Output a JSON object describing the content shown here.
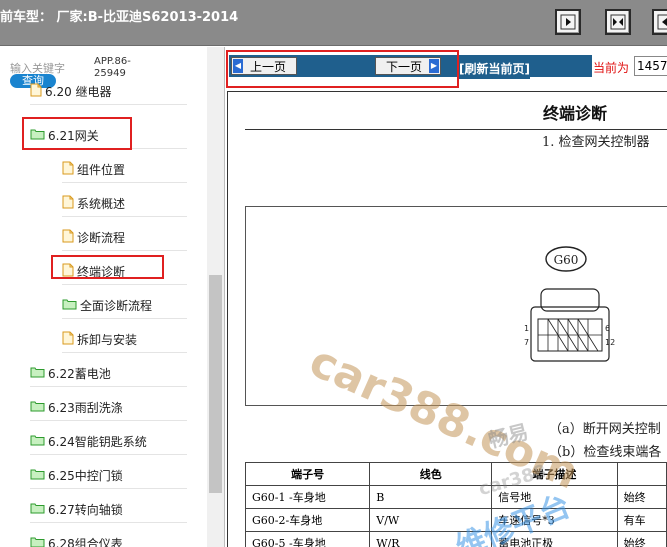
{
  "header": {
    "title": "前车型： 厂家:B-比亚迪S62013-2014",
    "dot": "·"
  },
  "sidebar": {
    "search_label": "输入关键字",
    "search_value_line1": "APP.86-",
    "search_value_line2": "25949",
    "search_button": "查询",
    "items": [
      {
        "label": "6.20  继电器",
        "type": "doc"
      },
      {
        "label": "6.21网关",
        "type": "folder"
      },
      {
        "label": "组件位置",
        "type": "doc"
      },
      {
        "label": "系统概述",
        "type": "doc"
      },
      {
        "label": "诊断流程",
        "type": "doc"
      },
      {
        "label": "终端诊断",
        "type": "doc"
      },
      {
        "label": "全面诊断流程",
        "type": "folder"
      },
      {
        "label": "拆卸与安装",
        "type": "doc"
      },
      {
        "label": "6.22蓄电池",
        "type": "folder"
      },
      {
        "label": "6.23雨刮洗涤",
        "type": "folder"
      },
      {
        "label": "6.24智能钥匙系统",
        "type": "folder"
      },
      {
        "label": "6.25中控门锁",
        "type": "folder"
      },
      {
        "label": "6.27转向轴锁",
        "type": "folder"
      },
      {
        "label": "6.28组合仪表",
        "type": "folder"
      }
    ]
  },
  "nav": {
    "prev_label": "上一页",
    "next_label": "下一页",
    "refresh_label": "[刷新当前页]",
    "current_label": "当前为",
    "current_value": "1457"
  },
  "document": {
    "title": "终端诊断",
    "step1": "1.   检查网关控制器",
    "connector_label": "G60",
    "pin_labels": [
      "1",
      "7",
      "6",
      "12"
    ],
    "note_a": "（a）断开网关控制",
    "note_b": "（b）检查线束端各",
    "table": {
      "headers": [
        "端子号",
        "线色",
        "端子描述",
        ""
      ],
      "rows": [
        [
          "G60-1 -车身地",
          "B",
          "信号地",
          "始终"
        ],
        [
          "G60-2-车身地",
          "V/W",
          "车速信号*3",
          "有车"
        ],
        [
          "G60-5 -车身地",
          "W/R",
          "蓄电池正极",
          "始终"
        ]
      ]
    }
  },
  "watermark": {
    "text1": "car388.com",
    "text2": "畅易",
    "text3": "car388",
    "text4": "维修平台"
  },
  "colors": {
    "topbar": "#8a8a8a",
    "navbar": "#1f5f8d",
    "accent_blue": "#1a84cf",
    "highlight_red": "#e02020"
  }
}
